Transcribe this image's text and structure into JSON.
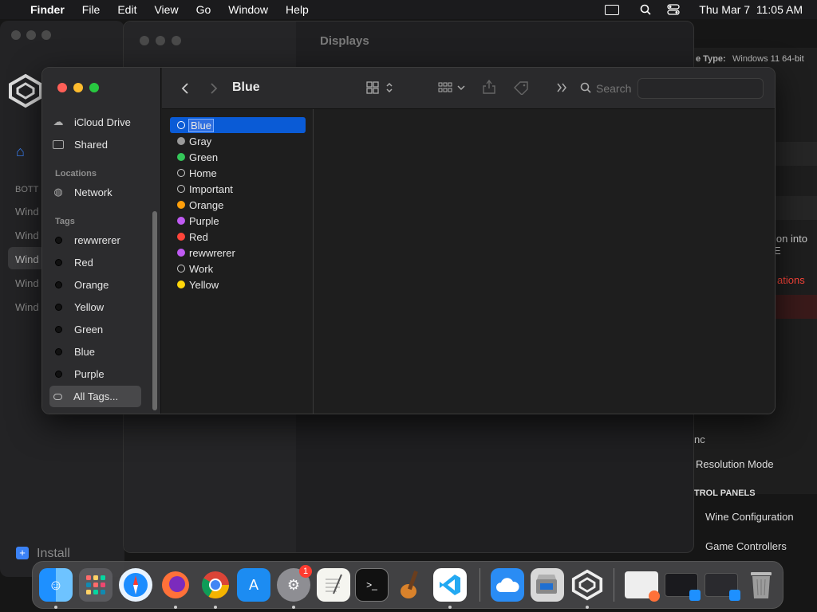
{
  "menubar": {
    "apple": "",
    "app": "Finder",
    "menus": [
      "File",
      "Edit",
      "View",
      "Go",
      "Window",
      "Help"
    ],
    "datetime": "Thu Mar 7  11:05 AM"
  },
  "bg": {
    "displays_title": "Displays",
    "left_items": [
      "BOTT",
      "Wind",
      "Wind",
      "Wind",
      "Wind",
      "Wind"
    ],
    "install": "Install",
    "right_texts": {
      "type_label": "e Type:",
      "type_value": "Windows 11 64-bit",
      "ion_into": "ion into E",
      "ations": "ations",
      "nc": "nc",
      "resolution": "Resolution Mode",
      "control_panels": "TROL PANELS",
      "wine_config": "Wine Configuration",
      "game_controllers": "Game Controllers"
    }
  },
  "finder": {
    "title": "Blue",
    "search_placeholder": "Search",
    "sidebar": {
      "icloud": "iCloud Drive",
      "shared": "Shared",
      "locations_header": "Locations",
      "network": "Network",
      "tags_header": "Tags",
      "tags": [
        "rewwrerer",
        "Red",
        "Orange",
        "Yellow",
        "Green",
        "Blue",
        "Purple"
      ],
      "all_tags": "All Tags..."
    },
    "tag_list": [
      {
        "label": "Blue",
        "color": "#0a5bd6",
        "hollow": true
      },
      {
        "label": "Gray",
        "color": "#9a9a9a",
        "hollow": false
      },
      {
        "label": "Green",
        "color": "#34c759",
        "hollow": false
      },
      {
        "label": "Home",
        "color": "",
        "hollow": true
      },
      {
        "label": "Important",
        "color": "",
        "hollow": true
      },
      {
        "label": "Orange",
        "color": "#ff9f0a",
        "hollow": false
      },
      {
        "label": "Purple",
        "color": "#bf5af2",
        "hollow": false
      },
      {
        "label": "Red",
        "color": "#ff453a",
        "hollow": false
      },
      {
        "label": "rewwrerer",
        "color": "#bf5af2",
        "hollow": false
      },
      {
        "label": "Work",
        "color": "",
        "hollow": true
      },
      {
        "label": "Yellow",
        "color": "#ffd60a",
        "hollow": false
      }
    ]
  },
  "dock": {
    "apps": [
      "finder",
      "launchpad",
      "safari",
      "firefox",
      "chrome",
      "app-store",
      "system-settings",
      "textedit",
      "terminal",
      "garageband",
      "vscode",
      "icloud",
      "boot-camp",
      "crossover",
      "window-1",
      "window-2",
      "window-3",
      "trash"
    ],
    "badge": "1"
  }
}
